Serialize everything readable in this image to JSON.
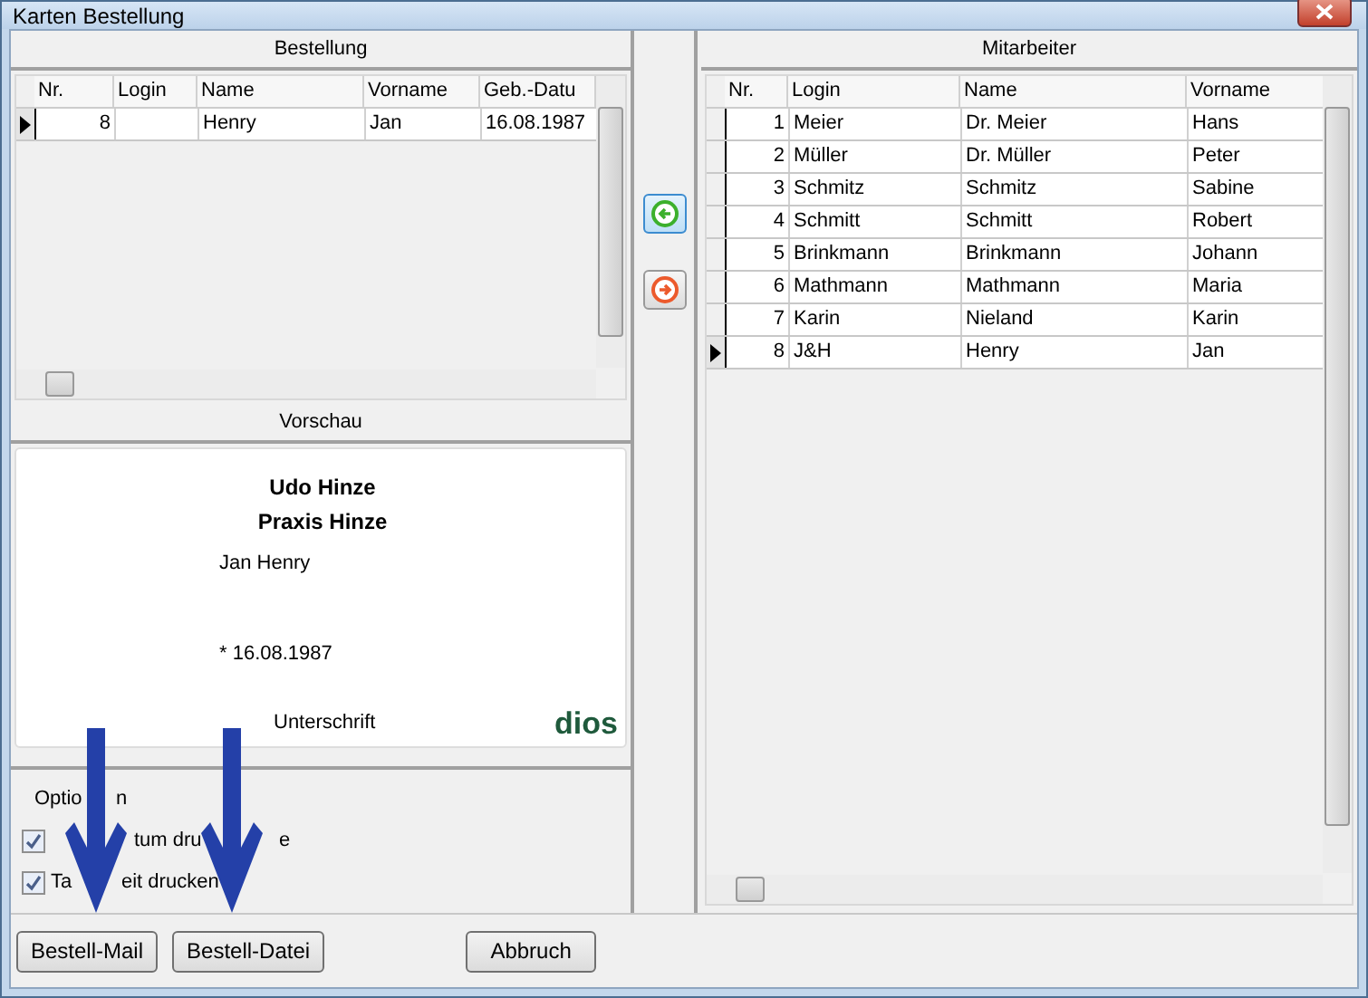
{
  "window": {
    "title": "Karten Bestellung"
  },
  "order": {
    "title": "Bestellung",
    "columns": [
      "Nr.",
      "Login",
      "Name",
      "Vorname",
      "Geb.-Datu"
    ],
    "rows": [
      {
        "selected": true,
        "cells": [
          "8",
          "",
          "Henry",
          "Jan",
          "16.08.1987"
        ]
      }
    ]
  },
  "preview": {
    "title": "Vorschau",
    "lines": [
      {
        "kind": "heading",
        "text": "Udo Hinze"
      },
      {
        "kind": "heading",
        "text": "Praxis Hinze"
      },
      {
        "kind": "name",
        "text": "Jan Henry"
      },
      {
        "kind": "birth",
        "text": "* 16.08.1987"
      },
      {
        "kind": "signature",
        "text": "Unterschrift"
      }
    ],
    "logo": "dios"
  },
  "options": {
    "title_parts": [
      "Optio",
      "n"
    ],
    "items": [
      {
        "label_parts": [
          "tum dru",
          "e"
        ],
        "checked": true
      },
      {
        "label_parts": [
          "Ta",
          "eit drucken"
        ],
        "checked": true
      }
    ]
  },
  "employees": {
    "title": "Mitarbeiter",
    "columns": [
      "Nr.",
      "Login",
      "Name",
      "Vorname"
    ],
    "rows": [
      {
        "selected": false,
        "cells": [
          "1",
          "Meier",
          "Dr. Meier",
          "Hans"
        ]
      },
      {
        "selected": false,
        "cells": [
          "2",
          "Müller",
          "Dr. Müller",
          "Peter"
        ]
      },
      {
        "selected": false,
        "cells": [
          "3",
          "Schmitz",
          "Schmitz",
          "Sabine"
        ]
      },
      {
        "selected": false,
        "cells": [
          "4",
          "Schmitt",
          "Schmitt",
          "Robert"
        ]
      },
      {
        "selected": false,
        "cells": [
          "5",
          "Brinkmann",
          "Brinkmann",
          "Johann"
        ]
      },
      {
        "selected": false,
        "cells": [
          "6",
          "Mathmann",
          "Mathmann",
          "Maria"
        ]
      },
      {
        "selected": false,
        "cells": [
          "7",
          "Karin",
          "Nieland",
          "Karin"
        ]
      },
      {
        "selected": true,
        "cells": [
          "8",
          "J&H",
          "Henry",
          "Jan"
        ]
      }
    ]
  },
  "buttons": [
    "Bestell-Mail",
    "Bestell-Datei",
    "Abbruch"
  ]
}
